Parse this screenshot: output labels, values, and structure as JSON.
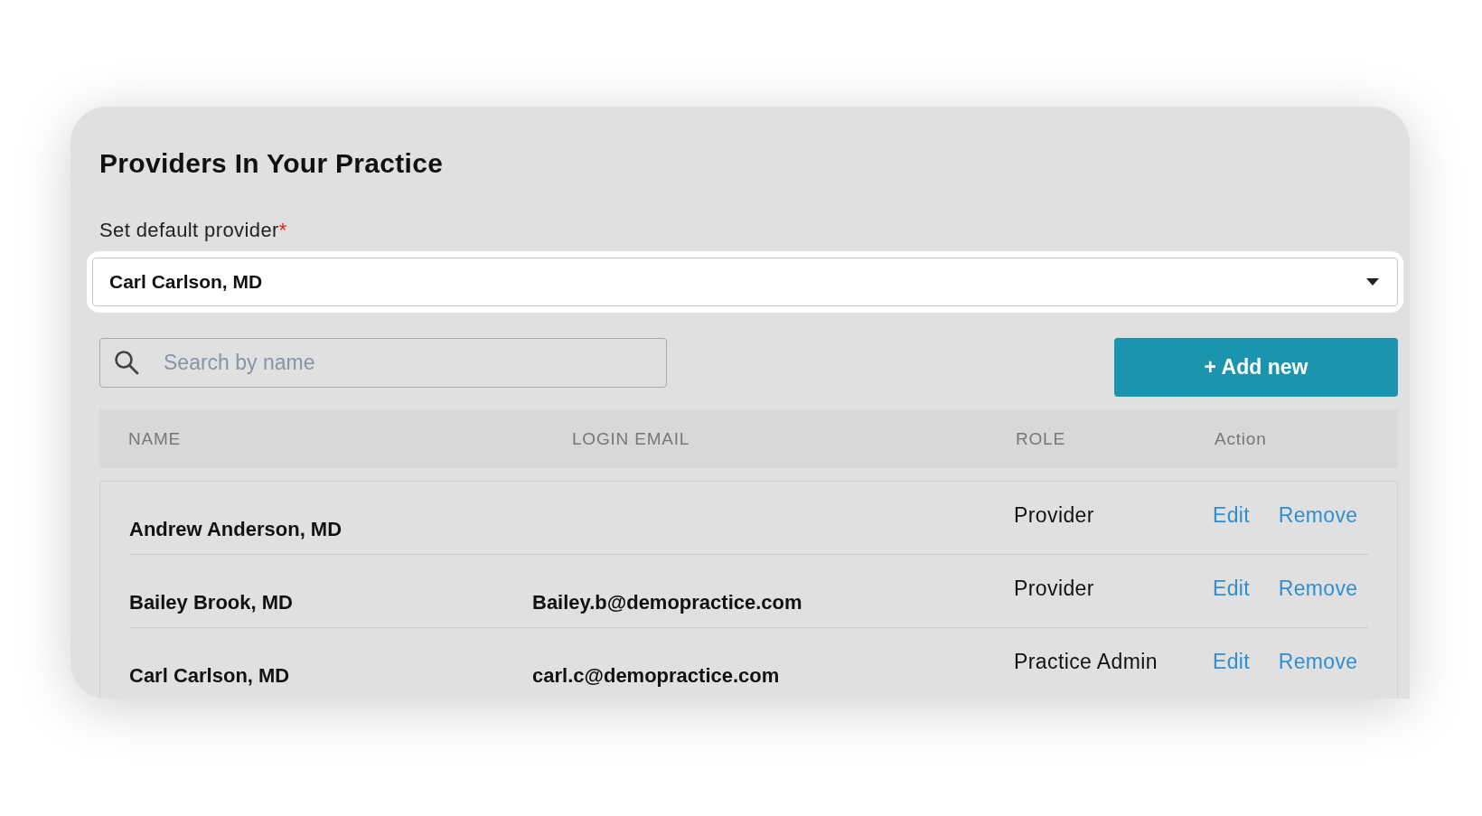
{
  "title": "Providers In Your Practice",
  "default_provider": {
    "label": "Set default provider",
    "required_mark": "*",
    "value": "Carl Carlson, MD"
  },
  "search": {
    "placeholder": "Search by name"
  },
  "add_button": "+ Add new",
  "table": {
    "columns": [
      "NAME",
      "LOGIN EMAIL",
      "ROLE",
      "Action"
    ],
    "rows": [
      {
        "name": "Andrew Anderson, MD",
        "email": "",
        "role": "Provider",
        "actions": [
          "Edit",
          "Remove"
        ]
      },
      {
        "name": "Bailey Brook, MD",
        "email": "Bailey.b@demopractice.com",
        "role": "Provider",
        "actions": [
          "Edit",
          "Remove"
        ]
      },
      {
        "name": "Carl Carlson, MD",
        "email": "carl.c@demopractice.com",
        "role": "Practice Admin",
        "actions": [
          "Edit",
          "Remove"
        ]
      }
    ]
  }
}
